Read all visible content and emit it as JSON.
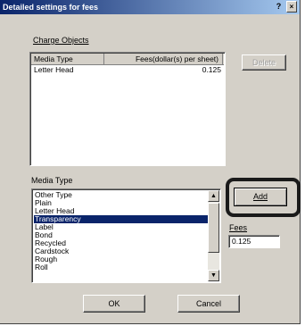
{
  "window": {
    "title": "Detailed settings for fees",
    "help_label": "?",
    "close_label": "×"
  },
  "charge_objects": {
    "group_label": "Charge Objects",
    "columns": [
      "Media Type",
      "Fees(dollar(s) per sheet)"
    ],
    "rows": [
      {
        "media_type": "Letter Head",
        "fee": "0.125"
      }
    ],
    "delete_label": "Delete"
  },
  "media_type": {
    "label": "Media Type",
    "items": [
      "Other Type",
      "Plain",
      "Letter Head",
      "Transparency",
      "Label",
      "Bond",
      "Recycled",
      "Cardstock",
      "Rough",
      "Roll"
    ],
    "selected_index": 3,
    "add_label": "Add"
  },
  "fees": {
    "label": "Fees",
    "value": "0.125"
  },
  "footer": {
    "ok_label": "OK",
    "cancel_label": "Cancel"
  },
  "colors": {
    "title_start": "#0a246a",
    "title_end": "#a6caf0",
    "dialog_bg": "#d4d0c8",
    "selection": "#0a246a"
  }
}
